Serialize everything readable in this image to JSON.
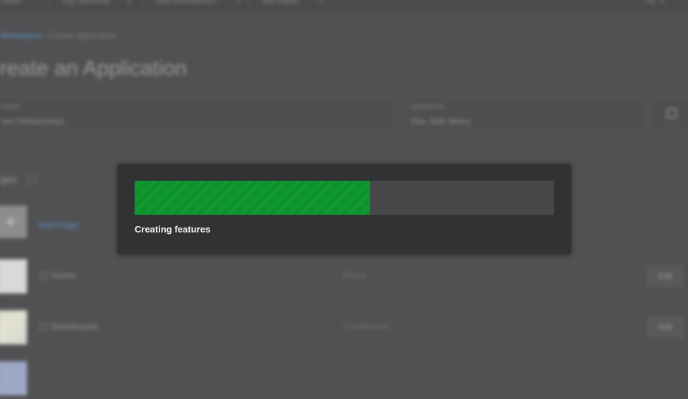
{
  "topbar": {
    "tabs": [
      "Studio",
      "SQL Workshop",
      "Team Development",
      "App Gallery"
    ],
    "user_label": "Pg"
  },
  "breadcrumb": {
    "link": "Workspace",
    "current": "Create Application"
  },
  "page_title": "reate an Application",
  "form": {
    "name_label": "Name",
    "name_value": "ion Olefsarsinea",
    "appearance_label": "Appearance",
    "appearance_value": "Vita, Side Menu"
  },
  "pages": {
    "heading": "ges",
    "add_label": "Add Page",
    "rows": [
      {
        "name": "Home",
        "type": "Blank",
        "edit_label": "Edit"
      },
      {
        "name": "Dashboard",
        "type": "Dashboard",
        "edit_label": "Edit"
      }
    ]
  },
  "progress_dialog": {
    "progress_fraction": 0.56,
    "status_text": "Creating features",
    "bar_color": "#0f9931",
    "track_color": "#464748"
  }
}
